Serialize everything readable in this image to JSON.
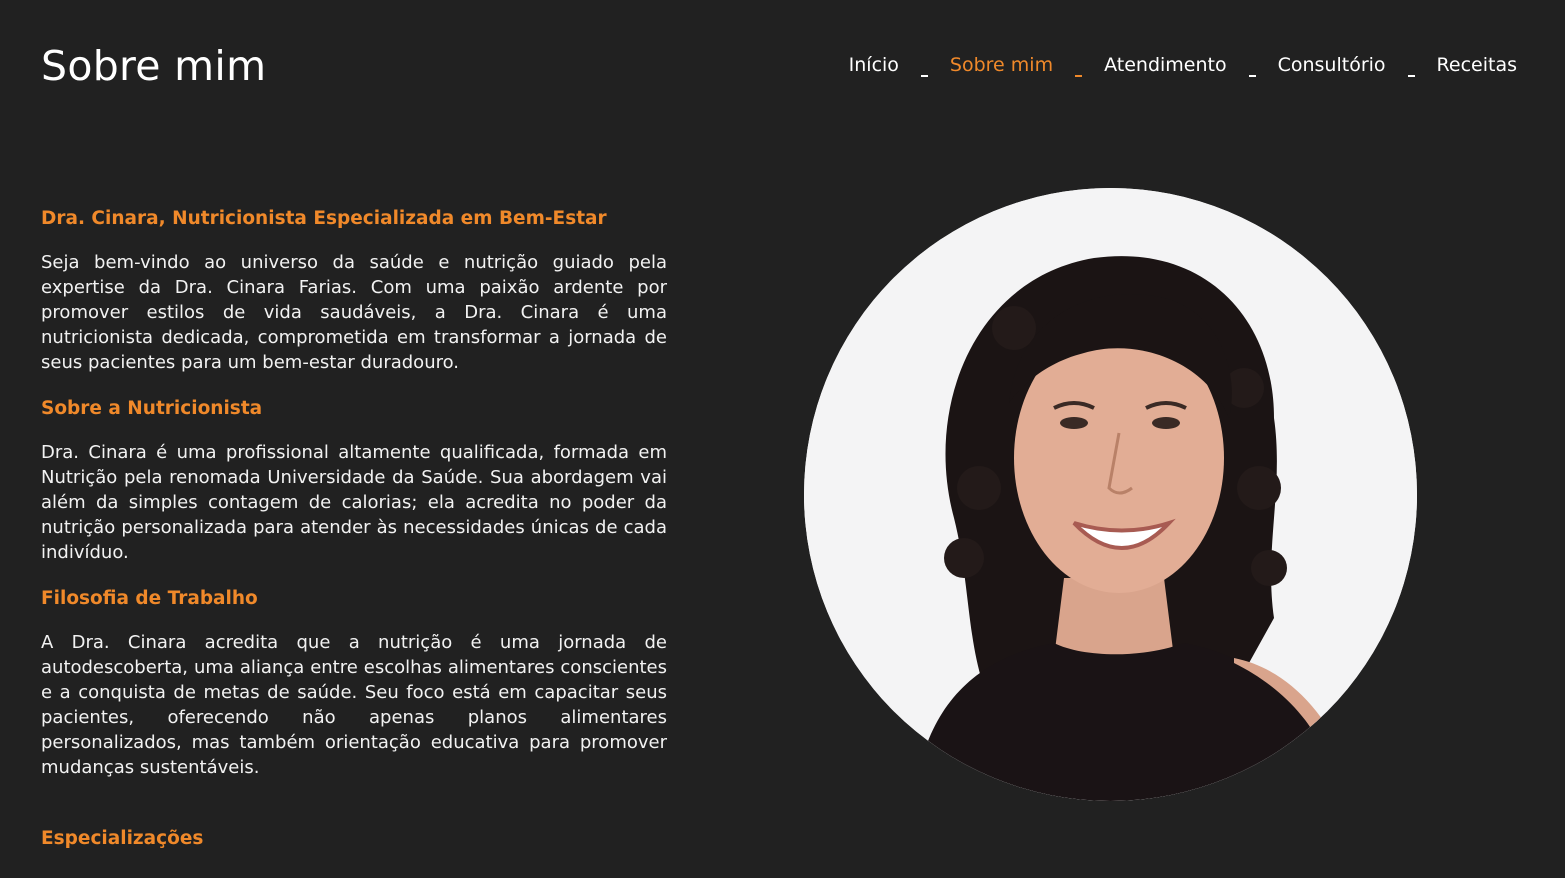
{
  "header": {
    "title": "Sobre mim"
  },
  "nav": {
    "items": [
      {
        "label": "Início",
        "active": false
      },
      {
        "label": "Sobre mim",
        "active": true
      },
      {
        "label": "Atendimento",
        "active": false
      },
      {
        "label": "Consultório",
        "active": false
      },
      {
        "label": "Receitas",
        "active": false
      }
    ]
  },
  "main": {
    "intro_heading": "Dra. Cinara, Nutricionista Especializada em Bem-Estar",
    "intro_text": "Seja bem-vindo ao universo da saúde e nutrição guiado pela expertise da Dra. Cinara Farias. Com uma paixão ardente por promover estilos de vida saudáveis, a Dra. Cinara é uma nutricionista dedicada, comprometida em transformar a jornada de seus pacientes para um bem-estar duradouro.",
    "about_heading": "Sobre a Nutricionista",
    "about_text": "Dra. Cinara é uma profissional altamente qualificada, formada em Nutrição pela renomada Universidade da Saúde. Sua abordagem vai além da simples contagem de calorias; ela acredita no poder da nutrição personalizada para atender às necessidades únicas de cada indivíduo.",
    "philosophy_heading": "Filosofia de Trabalho",
    "philosophy_text": "A Dra. Cinara acredita que a nutrição é uma jornada de autodescoberta, uma aliança entre escolhas alimentares conscientes e a conquista de metas de saúde. Seu foco está em capacitar seus pacientes, oferecendo não apenas planos alimentares personalizados, mas também orientação educativa para promover mudanças sustentáveis.",
    "specializations_heading": "Especializações"
  },
  "colors": {
    "background": "#212121",
    "accent": "#f0892a",
    "text": "#ffffff"
  },
  "icons": {
    "portrait": "profile-photo"
  }
}
